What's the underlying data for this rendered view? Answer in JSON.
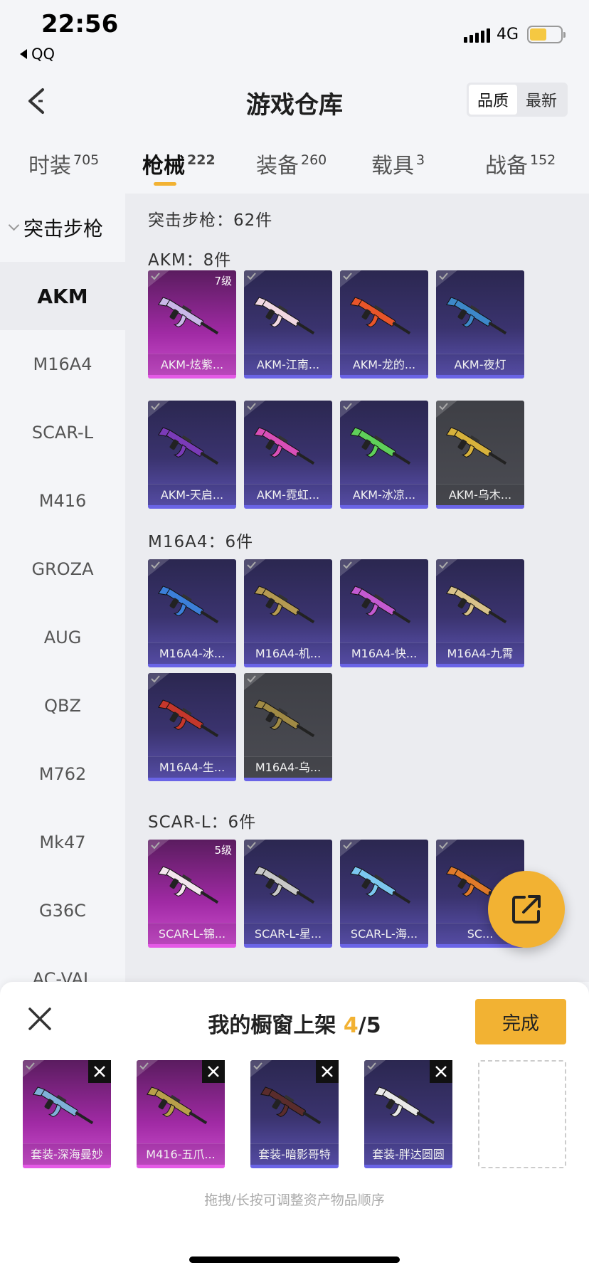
{
  "status_bar": {
    "time": "22:56",
    "back_app": "QQ",
    "network": "4G",
    "battery_level": 0.55
  },
  "header": {
    "title": "游戏仓库",
    "sort_options": [
      "品质",
      "最新"
    ],
    "selected_sort": "品质"
  },
  "tabs": [
    {
      "label": "时装",
      "count": "705"
    },
    {
      "label": "枪械",
      "count": "222",
      "active": true
    },
    {
      "label": "装备",
      "count": "260"
    },
    {
      "label": "载具",
      "count": "3"
    },
    {
      "label": "战备",
      "count": "152"
    }
  ],
  "sidebar": {
    "category": "突击步枪",
    "items": [
      "AKM",
      "M16A4",
      "SCAR-L",
      "M416",
      "GROZA",
      "AUG",
      "QBZ",
      "M762",
      "Mk47",
      "G36C",
      "AC-VAL"
    ],
    "active": "AKM"
  },
  "content": {
    "summary": "突击步枪：62件",
    "sections": [
      {
        "title": "AKM：8件",
        "items": [
          {
            "name": "AKM-炫紫...",
            "rarity": "pink",
            "level": "7级",
            "gun_color": "#c9b8e8"
          },
          {
            "name": "AKM-江南...",
            "rarity": "purple",
            "gun_color": "#f1d8e2"
          },
          {
            "name": "AKM-龙的...",
            "rarity": "purple",
            "gun_color": "#e8552a"
          },
          {
            "name": "AKM-夜灯",
            "rarity": "purple",
            "gun_color": "#3d88c9"
          },
          {
            "name": "AKM-天启...",
            "rarity": "purple",
            "gun_color": "#7a3bb8"
          },
          {
            "name": "AKM-霓虹...",
            "rarity": "purple",
            "gun_color": "#d94fb7"
          },
          {
            "name": "AKM-冰凉...",
            "rarity": "purple",
            "gun_color": "#5fcf5a"
          },
          {
            "name": "AKM-乌木...",
            "rarity": "gray",
            "gun_color": "#d7b23c"
          }
        ]
      },
      {
        "title": "M16A4：6件",
        "items": [
          {
            "name": "M16A4-冰...",
            "rarity": "purple",
            "gun_color": "#3c7fd9"
          },
          {
            "name": "M16A4-机...",
            "rarity": "purple",
            "gun_color": "#b59a52"
          },
          {
            "name": "M16A4-快...",
            "rarity": "purple",
            "gun_color": "#c35ad1"
          },
          {
            "name": "M16A4-九霄",
            "rarity": "purple",
            "gun_color": "#d8c28a"
          },
          {
            "name": "M16A4-生...",
            "rarity": "purple",
            "gun_color": "#c5372c"
          },
          {
            "name": "M16A4-乌...",
            "rarity": "gray",
            "gun_color": "#a08a45"
          }
        ]
      },
      {
        "title": "SCAR-L：6件",
        "items": [
          {
            "name": "SCAR-L-锦...",
            "rarity": "pink",
            "level": "5级",
            "gun_color": "#f4e6ee"
          },
          {
            "name": "SCAR-L-星...",
            "rarity": "purple",
            "gun_color": "#c8c8c8"
          },
          {
            "name": "SCAR-L-海...",
            "rarity": "purple",
            "gun_color": "#7cc7ef"
          },
          {
            "name": "SC...",
            "rarity": "purple",
            "gun_color": "#e07a2a"
          }
        ]
      }
    ]
  },
  "bottom_sheet": {
    "title_prefix": "我的橱窗上架 ",
    "count_current": "4",
    "count_total": "/5",
    "done_label": "完成",
    "slots": [
      {
        "name": "套装-深海曼妙",
        "rarity": "pink"
      },
      {
        "name": "M416-五爪...",
        "rarity": "pink"
      },
      {
        "name": "套装-暗影哥特",
        "rarity": "purple"
      },
      {
        "name": "套装-胖达圆圆",
        "rarity": "purple"
      }
    ],
    "hint": "拖拽/长按可调整资产物品顺序"
  }
}
